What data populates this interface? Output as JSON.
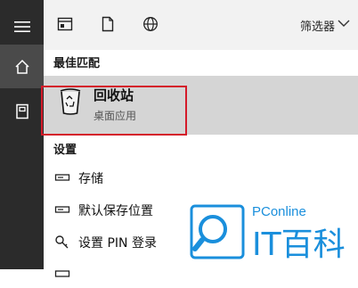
{
  "rail": {
    "items": [
      {
        "icon": "hamburger-menu-icon"
      },
      {
        "icon": "home-icon"
      },
      {
        "icon": "document-icon"
      }
    ]
  },
  "toolbar": {
    "filter_label": "筛选器"
  },
  "best_match": {
    "section_title": "最佳匹配",
    "title": "回收站",
    "subtitle": "桌面应用"
  },
  "settings": {
    "section_title": "设置",
    "items": [
      {
        "label": "存储",
        "icon": "storage-icon"
      },
      {
        "label": "默认保存位置",
        "icon": "storage-icon"
      },
      {
        "label": "设置 PIN 登录",
        "icon": "key-icon"
      }
    ]
  },
  "watermark": {
    "brand_top": "PConline",
    "brand_main": "IT百科"
  },
  "colors": {
    "rail_bg": "#2b2b2b",
    "rail_active": "#4a4a4a",
    "highlight_red": "#d41b2a",
    "brand_blue": "#1a8fdc"
  }
}
